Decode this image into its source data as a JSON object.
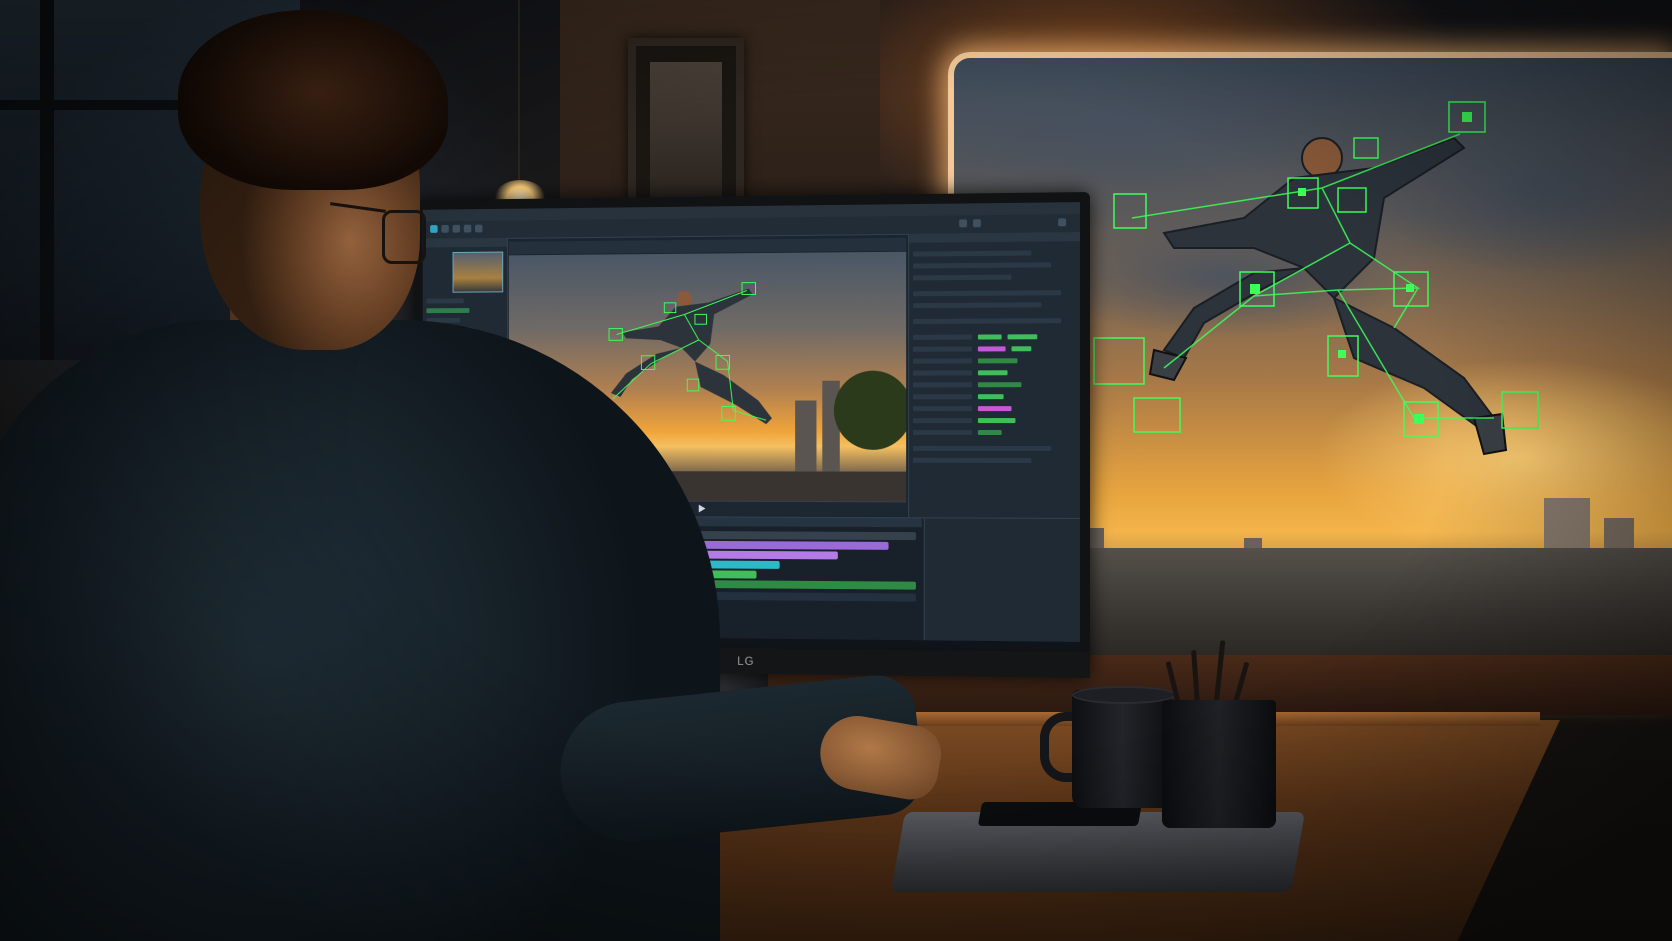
{
  "monitor": {
    "brand_logo": "LG"
  },
  "colors": {
    "tracking_green": "#3cff5a",
    "sunset_orange": "#f4b44a",
    "ui_panel": "#1f2a34",
    "track_purple": "#9a6ad8",
    "track_teal": "#2fb8c8",
    "track_green": "#3fbf5a"
  },
  "icons": [
    "play-icon"
  ]
}
